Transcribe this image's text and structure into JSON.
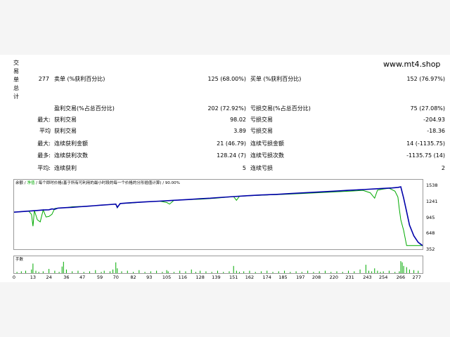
{
  "watermark": "www.mt4.shop",
  "side_label": [
    "交",
    "易",
    "单",
    "总",
    "计"
  ],
  "stats": {
    "total_trades": "277",
    "short_label": "卖单 (%获利百分比)",
    "short_value": "125 (68.00%)",
    "long_label": "买单 (%获利百分比)",
    "long_value": "152 (76.97%)",
    "profit_trades_label": "盈利交易(%占总百分比)",
    "profit_trades_value": "202 (72.92%)",
    "loss_trades_label": "亏损交易(%占总百分比)",
    "loss_trades_value": "75 (27.08%)",
    "largest_prefix": "最大:",
    "largest_profit_label": "获利交易",
    "largest_profit_value": "98.02",
    "largest_loss_label": "亏损交易",
    "largest_loss_value": "-204.93",
    "average_prefix": "平均",
    "average_profit_label": "获利交易",
    "average_profit_value": "3.89",
    "average_loss_label": "亏损交易",
    "average_loss_value": "-18.36",
    "max_prefix": "最大:",
    "max_consec_wins_label": "连续获利金额",
    "max_consec_wins_value": "21 (46.79)",
    "max_consec_losses_label": "连续亏损金额",
    "max_consec_losses_value": "14 (-1135.75)",
    "most_prefix": "最多:",
    "most_consec_profit_label": "连续获利次数",
    "most_consec_profit_value": "128.24 (7)",
    "most_consec_loss_label": "连续亏损次数",
    "most_consec_loss_value": "-1135.75 (14)",
    "avg_prefix": "平均:",
    "avg_consec_wins_label": "连续获利",
    "avg_consec_wins_value": "5",
    "avg_consec_losses_label": "连续亏损",
    "avg_consec_losses_value": "2"
  },
  "chart_data": {
    "type": "line",
    "title_parts": [
      "余额",
      "净值",
      "每个即时价格(基于所有可利用的最小时段的每一个价格的分形插值计算)",
      "90.00%"
    ],
    "y_ticks": [
      1538,
      1241,
      945,
      648,
      352
    ],
    "ylim": [
      352,
      1538
    ],
    "x_ticks": [
      0,
      13,
      24,
      36,
      47,
      59,
      70,
      82,
      93,
      105,
      116,
      128,
      139,
      151,
      162,
      174,
      185,
      197,
      208,
      220,
      231,
      243,
      254,
      266,
      277
    ],
    "xlim": [
      0,
      281
    ],
    "series": [
      {
        "name": "余额",
        "color": "#0000aa",
        "x": [
          0,
          5,
          10,
          15,
          20,
          24,
          26,
          28,
          30,
          33,
          36,
          40,
          45,
          50,
          55,
          60,
          65,
          70,
          71,
          72,
          73,
          75,
          80,
          90,
          100,
          110,
          120,
          128,
          135,
          140,
          151,
          160,
          170,
          180,
          190,
          200,
          210,
          220,
          230,
          240,
          250,
          260,
          264,
          266,
          268,
          270,
          272,
          275,
          278,
          281
        ],
        "y": [
          1040,
          1050,
          1060,
          1070,
          1080,
          1085,
          1100,
          1095,
          1115,
          1120,
          1125,
          1130,
          1140,
          1150,
          1160,
          1170,
          1180,
          1190,
          1130,
          1165,
          1200,
          1205,
          1215,
          1230,
          1245,
          1260,
          1275,
          1290,
          1300,
          1310,
          1330,
          1345,
          1360,
          1370,
          1385,
          1400,
          1415,
          1430,
          1445,
          1460,
          1475,
          1490,
          1500,
          1510,
          1300,
          1050,
          800,
          600,
          480,
          420
        ]
      },
      {
        "name": "净值",
        "color": "#00aa00",
        "x": [
          0,
          10,
          12,
          13,
          14,
          16,
          18,
          20,
          22,
          24,
          26,
          28,
          30,
          32,
          36,
          40,
          50,
          60,
          70,
          71,
          73,
          80,
          90,
          100,
          105,
          107,
          110,
          116,
          120,
          128,
          139,
          151,
          153,
          155,
          162,
          174,
          185,
          197,
          208,
          220,
          231,
          240,
          245,
          248,
          250,
          254,
          258,
          262,
          264,
          265,
          266,
          268,
          270,
          272,
          275,
          281
        ],
        "y": [
          1040,
          1060,
          1000,
          780,
          1070,
          900,
          860,
          1080,
          950,
          960,
          1000,
          1110,
          1115,
          1120,
          1125,
          1140,
          1150,
          1170,
          1190,
          1120,
          1200,
          1210,
          1230,
          1245,
          1220,
          1190,
          1260,
          1270,
          1275,
          1280,
          1300,
          1330,
          1260,
          1335,
          1345,
          1360,
          1370,
          1385,
          1400,
          1415,
          1430,
          1445,
          1400,
          1300,
          1450,
          1470,
          1485,
          1430,
          1320,
          1100,
          900,
          700,
          420,
          420,
          420,
          420
        ]
      }
    ]
  },
  "volume": {
    "title": "手数",
    "bars_x": [
      2,
      5,
      8,
      12,
      13,
      15,
      17,
      20,
      24,
      28,
      31,
      33,
      34,
      36,
      40,
      44,
      48,
      52,
      56,
      60,
      62,
      66,
      68,
      70,
      71,
      74,
      78,
      82,
      86,
      90,
      94,
      98,
      102,
      105,
      106,
      110,
      114,
      118,
      122,
      125,
      128,
      132,
      136,
      140,
      144,
      148,
      151,
      153,
      155,
      158,
      162,
      166,
      170,
      174,
      178,
      182,
      186,
      190,
      194,
      198,
      202,
      206,
      210,
      214,
      218,
      222,
      226,
      230,
      234,
      238,
      242,
      244,
      246,
      248,
      250,
      252,
      254,
      258,
      262,
      265,
      266,
      267,
      268,
      270,
      272,
      275,
      278
    ],
    "bars_h": [
      0.1,
      0.15,
      0.2,
      0.3,
      0.8,
      0.2,
      0.1,
      0.15,
      0.35,
      0.2,
      0.1,
      0.55,
      0.95,
      0.3,
      0.15,
      0.2,
      0.1,
      0.15,
      0.25,
      0.1,
      0.2,
      0.15,
      0.3,
      0.9,
      0.4,
      0.15,
      0.2,
      0.1,
      0.25,
      0.1,
      0.15,
      0.2,
      0.1,
      0.25,
      0.15,
      0.1,
      0.2,
      0.15,
      0.3,
      0.1,
      0.2,
      0.15,
      0.1,
      0.2,
      0.1,
      0.15,
      0.6,
      0.2,
      0.1,
      0.15,
      0.2,
      0.1,
      0.15,
      0.2,
      0.1,
      0.15,
      0.2,
      0.1,
      0.15,
      0.1,
      0.2,
      0.1,
      0.15,
      0.2,
      0.1,
      0.15,
      0.1,
      0.2,
      0.15,
      0.3,
      0.7,
      0.2,
      0.15,
      0.4,
      0.2,
      0.1,
      0.15,
      0.2,
      0.1,
      0.15,
      1.0,
      0.9,
      0.6,
      0.5,
      0.3,
      0.25,
      0.2
    ]
  }
}
